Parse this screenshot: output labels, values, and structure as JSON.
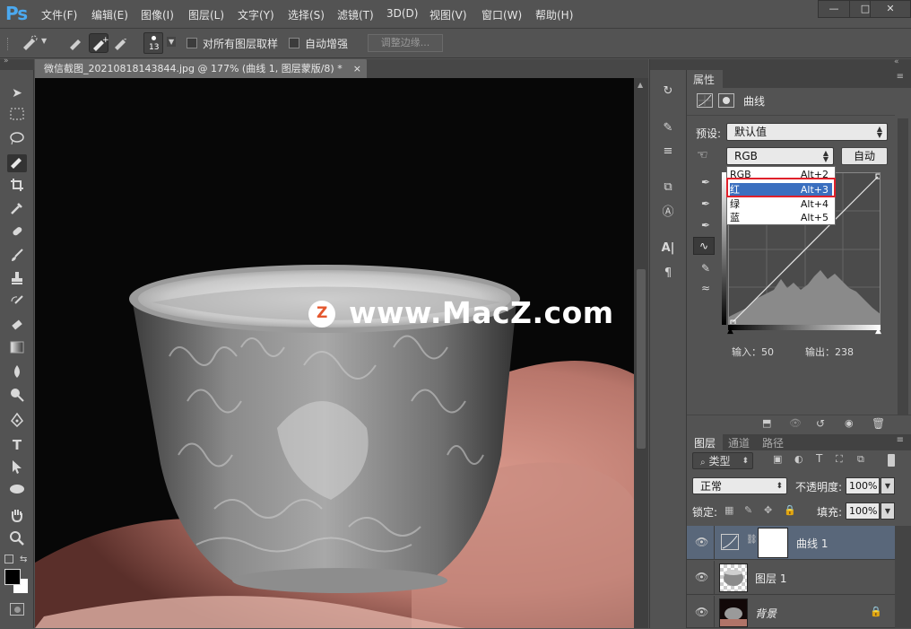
{
  "app": {
    "logo": "Ps"
  },
  "menu": [
    "文件(F)",
    "编辑(E)",
    "图像(I)",
    "图层(L)",
    "文字(Y)",
    "选择(S)",
    "滤镜(T)",
    "3D(D)",
    "视图(V)",
    "窗口(W)",
    "帮助(H)"
  ],
  "window_controls": {
    "minimize": "—",
    "maximize": "□",
    "close": "✕"
  },
  "options": {
    "brush_size": "13",
    "sample_all_label": "对所有图层取样",
    "auto_enhance_label": "自动增强",
    "refine_edge_label": "调整边缘..."
  },
  "document": {
    "tab_title": "微信截图_20210818143844.jpg @ 177% (曲线 1, 图层蒙版/8) *",
    "close": "×",
    "watermark": "www.MacZ.com",
    "watermark_badge": "Z"
  },
  "properties": {
    "tab": "属性",
    "adjustment_title": "曲线",
    "preset_label": "预设:",
    "preset_value": "默认值",
    "channel_value": "RGB",
    "auto_button": "自动",
    "channel_options": [
      {
        "label": "RGB",
        "shortcut": "Alt+2"
      },
      {
        "label": "红",
        "shortcut": "Alt+3"
      },
      {
        "label": "绿",
        "shortcut": "Alt+4"
      },
      {
        "label": "蓝",
        "shortcut": "Alt+5"
      }
    ],
    "selected_channel": "红",
    "input_label": "输入：50",
    "output_label": "输出：238"
  },
  "layers": {
    "tabs": [
      "图层",
      "通道",
      "路径"
    ],
    "filter_kind": "类型",
    "blend_mode": "正常",
    "opacity_label": "不透明度:",
    "opacity_value": "100%",
    "lock_label": "锁定:",
    "fill_label": "填充:",
    "fill_value": "100%",
    "items": [
      {
        "name": "曲线 1"
      },
      {
        "name": "图层 1"
      },
      {
        "name": "背景"
      }
    ]
  },
  "colors": {
    "accent": "#4ba9f0",
    "highlight": "#e0212b",
    "selection": "#3b6fbf"
  }
}
